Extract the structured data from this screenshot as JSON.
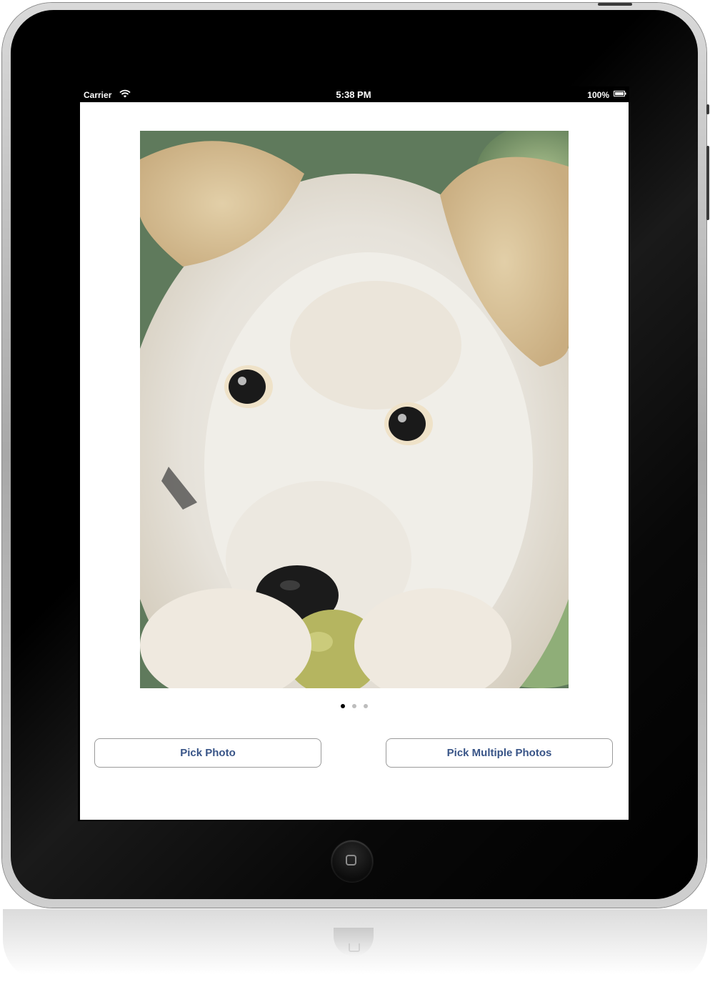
{
  "status_bar": {
    "carrier": "Carrier",
    "time": "5:38 PM",
    "battery": "100%",
    "icons": [
      "wifi-icon",
      "battery-icon"
    ]
  },
  "main": {
    "photo": {
      "subject": "puppy photo"
    },
    "page_control": {
      "total_pages": 3,
      "current_page": 1
    },
    "buttons": {
      "pick_photo": "Pick Photo",
      "pick_multiple": "Pick Multiple Photos"
    }
  },
  "colors": {
    "button_text": "#385487",
    "button_border": "#9a9a9a",
    "status_bar_bg": "#000000",
    "app_bg": "#ffffff"
  }
}
